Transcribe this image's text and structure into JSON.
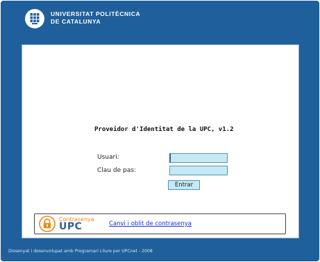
{
  "header": {
    "university_line1": "UNIVERSITAT POLITÈCNICA",
    "university_line2": "DE CATALUNYA"
  },
  "login": {
    "title": "Proveidor d'Identitat de la UPC, v1.2",
    "username_label": "Usuari:",
    "username_value": "",
    "password_label": "Clau de pas:",
    "password_value": "",
    "submit_label": "Entrar"
  },
  "password_service": {
    "brand_line1": "Contrasenya",
    "brand_line2": "UPC",
    "link_label": "Canvi i oblit de contrasenya"
  },
  "footer": {
    "text": "Dissenyat i desenvolupat amb Programari Lliure per UPCnet - 2008"
  },
  "colors": {
    "frame_blue": "#1f5f9c",
    "input_fill": "#c3eaf5",
    "link_blue": "#1a2fd8",
    "brand_orange": "#e98a1a"
  },
  "icons": {
    "logo": "upc-logo-icon",
    "lock": "lock-icon"
  }
}
